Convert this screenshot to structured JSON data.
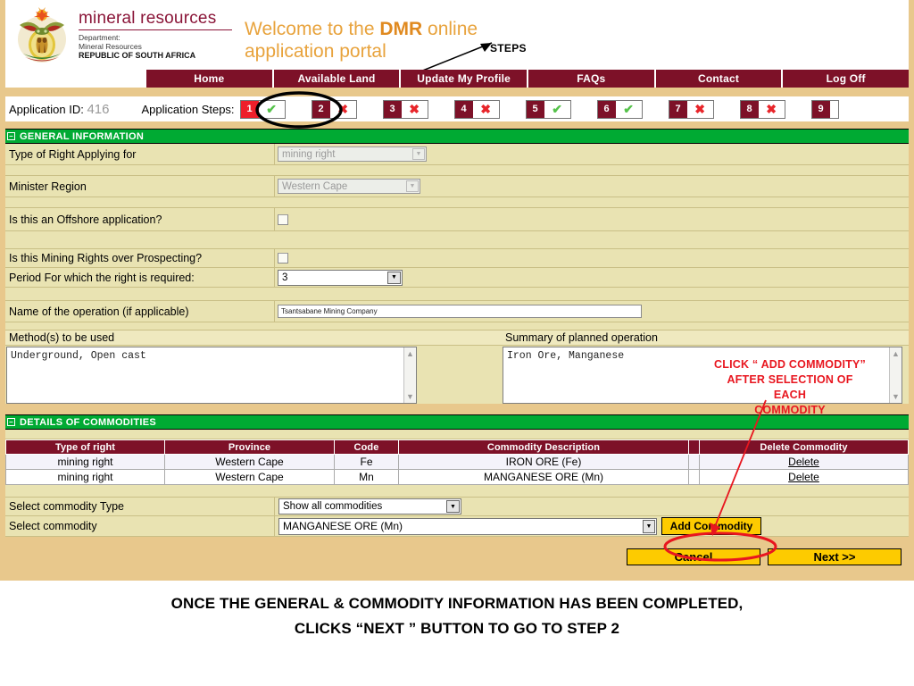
{
  "header": {
    "department_title": "mineral resources",
    "department_line1": "Department:",
    "department_line2": "Mineral Resources",
    "department_line3": "REPUBLIC OF SOUTH AFRICA",
    "welcome_line1_pre": "Welcome to the ",
    "welcome_line1_brand": "DMR",
    "welcome_line1_post": " online",
    "welcome_line2": "application portal",
    "crest_alt": "south-african-coat-of-arms"
  },
  "annotations": {
    "steps_label": "STEPS",
    "add_commodity_note": "CLICK “ ADD COMMODITY” AFTER SELECTION OF EACH COMMODITY",
    "add_commodity_note_lines": [
      "CLICK “ ADD COMMODITY”",
      "AFTER SELECTION OF EACH",
      "COMMODITY"
    ],
    "caption_line1": "ONCE THE GENERAL & COMMODITY INFORMATION HAS BEEN COMPLETED,",
    "caption_line2": "CLICKS “NEXT ” BUTTON TO GO TO STEP 2"
  },
  "nav": {
    "items": [
      {
        "label": "Home"
      },
      {
        "label": "Available Land"
      },
      {
        "label": "Update My Profile"
      },
      {
        "label": "FAQs"
      },
      {
        "label": "Contact"
      },
      {
        "label": "Log Off"
      }
    ]
  },
  "steps_bar": {
    "application_id_label": "Application ID:",
    "application_id_value": "416",
    "application_steps_label": "Application Steps:",
    "steps": [
      {
        "number": "1",
        "status": "ok",
        "active": true
      },
      {
        "number": "2",
        "status": "bad",
        "active": false
      },
      {
        "number": "3",
        "status": "bad",
        "active": false
      },
      {
        "number": "4",
        "status": "bad",
        "active": false
      },
      {
        "number": "5",
        "status": "ok",
        "active": false
      },
      {
        "number": "6",
        "status": "ok",
        "active": false
      },
      {
        "number": "7",
        "status": "bad",
        "active": false
      },
      {
        "number": "8",
        "status": "bad",
        "active": false
      },
      {
        "number": "9",
        "status": "blank",
        "active": false
      }
    ]
  },
  "general_information": {
    "section_title": "GENERAL INFORMATION",
    "toggle_glyph": "−",
    "type_of_right_label": "Type of Right Applying for",
    "type_of_right_value": "mining right",
    "minister_region_label": "Minister Region",
    "minister_region_value": "Western Cape",
    "offshore_label": "Is this an Offshore application?",
    "offshore_checked": false,
    "mining_over_prospecting_label": "Is this Mining Rights over Prospecting?",
    "mining_over_prospecting_checked": false,
    "period_label": "Period For which the right is required:",
    "period_value": "3",
    "operation_name_label": "Name of the operation (if applicable)",
    "operation_name_value": "Tsantsabane Mining Company",
    "methods_label": "Method(s) to be used",
    "methods_value": "Underground, Open cast",
    "summary_label": "Summary of planned operation",
    "summary_value": "Iron Ore, Manganese"
  },
  "commodities": {
    "section_title": "DETAILS OF COMMODITIES",
    "toggle_glyph": "−",
    "columns": [
      "Type of right",
      "Province",
      "Code",
      "Commodity Description",
      "",
      "Delete Commodity"
    ],
    "rows": [
      {
        "type_of_right": "mining right",
        "province": "Western Cape",
        "code": "Fe",
        "description": "IRON ORE (Fe)",
        "delete_label": "Delete"
      },
      {
        "type_of_right": "mining right",
        "province": "Western Cape",
        "code": "Mn",
        "description": "MANGANESE ORE (Mn)",
        "delete_label": "Delete"
      }
    ],
    "select_type_label": "Select commodity Type",
    "select_type_value": "Show all commodities",
    "select_commodity_label": "Select commodity",
    "select_commodity_value": "MANGANESE ORE (Mn)",
    "add_commodity_button": "Add Commodity"
  },
  "footer_buttons": {
    "cancel": "Cancel",
    "next": "Next >>"
  },
  "colors": {
    "nav_maroon": "#7d1128",
    "section_green": "#00aa33",
    "page_tan": "#e8c88c",
    "form_khaki": "#e9e3b2",
    "button_yellow": "#fdcb00",
    "annotation_red": "#e8161f",
    "active_step_red": "#ee1f2a",
    "dept_maroon": "#8a1538",
    "welcome_orange": "#e8a33d"
  }
}
